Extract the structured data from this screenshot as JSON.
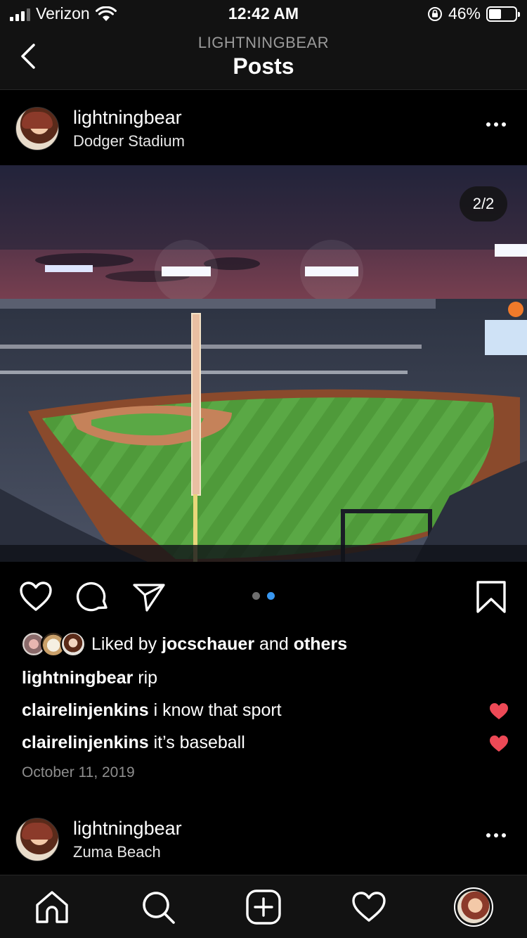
{
  "status_bar": {
    "carrier": "Verizon",
    "time": "12:42 AM",
    "battery": "46%",
    "battery_level": 0.46,
    "icons": [
      "signal-icon",
      "wifi-icon",
      "rotation-lock-icon",
      "battery-icon"
    ]
  },
  "nav": {
    "subtitle": "LIGHTNINGBEAR",
    "title": "Posts",
    "back_icon": "chevron-left-icon"
  },
  "post": {
    "username": "lightningbear",
    "location": "Dodger Stadium",
    "image_alt": "Dodger Stadium at night",
    "carousel_counter": "2/2",
    "carousel_pages": 2,
    "carousel_active": 2,
    "likes": {
      "prefix": "Liked by ",
      "user": "jocschauer",
      "middle": " and ",
      "others": "others"
    },
    "caption": {
      "user": "lightningbear",
      "text": " rip"
    },
    "comments": [
      {
        "user": "clairelinjenkins",
        "text": " i know that sport",
        "liked": true
      },
      {
        "user": "clairelinjenkins",
        "text": " it’s baseball",
        "liked": true
      }
    ],
    "date": "October 11, 2019"
  },
  "next_post": {
    "username": "lightningbear",
    "location": "Zuma Beach"
  },
  "tabbar": {
    "items": [
      "home-icon",
      "search-icon",
      "new-post-icon",
      "activity-icon",
      "profile-avatar"
    ]
  },
  "colors": {
    "background": "#000000",
    "bar_background": "#121212",
    "accent_blue": "#3897f0",
    "like_red": "#ed4956",
    "muted_text": "#8e8e8e"
  }
}
